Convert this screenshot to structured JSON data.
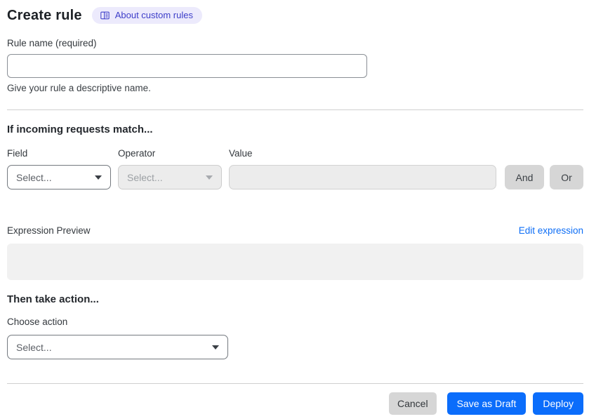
{
  "page": {
    "title": "Create rule",
    "about_badge_label": "About custom rules"
  },
  "rule_name": {
    "label": "Rule name (required)",
    "value": "",
    "helper": "Give your rule a descriptive name."
  },
  "match_section": {
    "heading": "If incoming requests match...",
    "field": {
      "label": "Field",
      "placeholder": "Select..."
    },
    "operator": {
      "label": "Operator",
      "placeholder": "Select..."
    },
    "value": {
      "label": "Value",
      "value": ""
    },
    "and_label": "And",
    "or_label": "Or"
  },
  "expression": {
    "label": "Expression Preview",
    "edit_link": "Edit expression",
    "preview": ""
  },
  "action_section": {
    "heading": "Then take action...",
    "choose_label": "Choose action",
    "placeholder": "Select..."
  },
  "footer": {
    "cancel": "Cancel",
    "save_draft": "Save as Draft",
    "deploy": "Deploy"
  },
  "icons": {
    "badge": "book-icon",
    "selects": "chevron-down-icon"
  },
  "colors": {
    "primary_button": "#0b6dfb",
    "link": "#0e6ef6",
    "badge_bg": "#eceafc",
    "badge_text": "#3d3ec9",
    "gray_button": "#d6d6d6",
    "disabled_bg": "#ececec",
    "preview_bg": "#f1f1f1",
    "divider": "#cfcfcf"
  }
}
